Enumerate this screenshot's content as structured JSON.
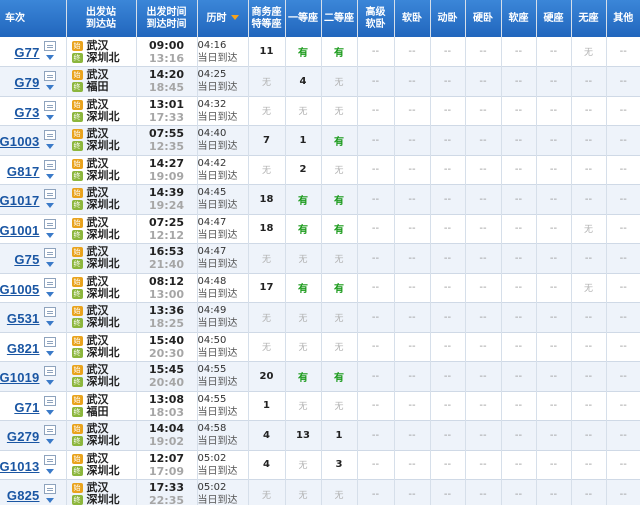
{
  "header": {
    "train": "车次",
    "station_from": "出发站",
    "station_to": "到达站",
    "time_dep": "出发时间",
    "time_arr": "到达时间",
    "duration": "历时",
    "seats": [
      {
        "line1": "商务座",
        "line2": "特等座"
      },
      {
        "line1": "一等座",
        "line2": ""
      },
      {
        "line1": "二等座",
        "line2": ""
      },
      {
        "line1": "高级",
        "line2": "软卧"
      },
      {
        "line1": "软卧",
        "line2": ""
      },
      {
        "line1": "动卧",
        "line2": ""
      },
      {
        "line1": "硬卧",
        "line2": ""
      },
      {
        "line1": "软座",
        "line2": ""
      },
      {
        "line1": "硬座",
        "line2": ""
      },
      {
        "line1": "无座",
        "line2": ""
      },
      {
        "line1": "其他",
        "line2": ""
      }
    ]
  },
  "accent": {
    "header_blue": "#2a72c9",
    "link_blue": "#1a56a3",
    "available_green": "#1a9a1a",
    "from_badge": "#e9a31d",
    "to_badge": "#8cb63c"
  },
  "icons": {
    "from_badge": "始",
    "to_badge": "终",
    "stopover": "list-icon",
    "expand": "chevron-down-icon",
    "sort": "sort-arrow-icon"
  },
  "rows": [
    {
      "train": "G77",
      "from": "武汉",
      "to": "深圳北",
      "dep": "09:00",
      "arr": "13:16",
      "dur": "04:16",
      "day": "当日到达",
      "seats": [
        "11",
        "有",
        "有",
        "--",
        "--",
        "--",
        "--",
        "--",
        "--",
        "无",
        "--"
      ]
    },
    {
      "train": "G79",
      "from": "武汉",
      "to": "福田",
      "dep": "14:20",
      "arr": "18:45",
      "dur": "04:25",
      "day": "当日到达",
      "seats": [
        "无",
        "4",
        "无",
        "--",
        "--",
        "--",
        "--",
        "--",
        "--",
        "--",
        "--"
      ]
    },
    {
      "train": "G73",
      "from": "武汉",
      "to": "深圳北",
      "dep": "13:01",
      "arr": "17:33",
      "dur": "04:32",
      "day": "当日到达",
      "seats": [
        "无",
        "无",
        "无",
        "--",
        "--",
        "--",
        "--",
        "--",
        "--",
        "--",
        "--"
      ]
    },
    {
      "train": "G1003",
      "from": "武汉",
      "to": "深圳北",
      "dep": "07:55",
      "arr": "12:35",
      "dur": "04:40",
      "day": "当日到达",
      "seats": [
        "7",
        "1",
        "有",
        "--",
        "--",
        "--",
        "--",
        "--",
        "--",
        "--",
        "--"
      ]
    },
    {
      "train": "G817",
      "from": "武汉",
      "to": "深圳北",
      "dep": "14:27",
      "arr": "19:09",
      "dur": "04:42",
      "day": "当日到达",
      "seats": [
        "无",
        "2",
        "无",
        "--",
        "--",
        "--",
        "--",
        "--",
        "--",
        "--",
        "--"
      ]
    },
    {
      "train": "G1017",
      "from": "武汉",
      "to": "深圳北",
      "dep": "14:39",
      "arr": "19:24",
      "dur": "04:45",
      "day": "当日到达",
      "seats": [
        "18",
        "有",
        "有",
        "--",
        "--",
        "--",
        "--",
        "--",
        "--",
        "--",
        "--"
      ]
    },
    {
      "train": "G1001",
      "from": "武汉",
      "to": "深圳北",
      "dep": "07:25",
      "arr": "12:12",
      "dur": "04:47",
      "day": "当日到达",
      "seats": [
        "18",
        "有",
        "有",
        "--",
        "--",
        "--",
        "--",
        "--",
        "--",
        "无",
        "--"
      ]
    },
    {
      "train": "G75",
      "from": "武汉",
      "to": "深圳北",
      "dep": "16:53",
      "arr": "21:40",
      "dur": "04:47",
      "day": "当日到达",
      "seats": [
        "无",
        "无",
        "无",
        "--",
        "--",
        "--",
        "--",
        "--",
        "--",
        "--",
        "--"
      ]
    },
    {
      "train": "G1005",
      "from": "武汉",
      "to": "深圳北",
      "dep": "08:12",
      "arr": "13:00",
      "dur": "04:48",
      "day": "当日到达",
      "seats": [
        "17",
        "有",
        "有",
        "--",
        "--",
        "--",
        "--",
        "--",
        "--",
        "无",
        "--"
      ]
    },
    {
      "train": "G531",
      "from": "武汉",
      "to": "深圳北",
      "dep": "13:36",
      "arr": "18:25",
      "dur": "04:49",
      "day": "当日到达",
      "seats": [
        "无",
        "无",
        "无",
        "--",
        "--",
        "--",
        "--",
        "--",
        "--",
        "--",
        "--"
      ]
    },
    {
      "train": "G821",
      "from": "武汉",
      "to": "深圳北",
      "dep": "15:40",
      "arr": "20:30",
      "dur": "04:50",
      "day": "当日到达",
      "seats": [
        "无",
        "无",
        "无",
        "--",
        "--",
        "--",
        "--",
        "--",
        "--",
        "--",
        "--"
      ]
    },
    {
      "train": "G1019",
      "from": "武汉",
      "to": "深圳北",
      "dep": "15:45",
      "arr": "20:40",
      "dur": "04:55",
      "day": "当日到达",
      "seats": [
        "20",
        "有",
        "有",
        "--",
        "--",
        "--",
        "--",
        "--",
        "--",
        "--",
        "--"
      ]
    },
    {
      "train": "G71",
      "from": "武汉",
      "to": "福田",
      "dep": "13:08",
      "arr": "18:03",
      "dur": "04:55",
      "day": "当日到达",
      "seats": [
        "1",
        "无",
        "无",
        "--",
        "--",
        "--",
        "--",
        "--",
        "--",
        "--",
        "--"
      ]
    },
    {
      "train": "G279",
      "from": "武汉",
      "to": "深圳北",
      "dep": "14:04",
      "arr": "19:02",
      "dur": "04:58",
      "day": "当日到达",
      "seats": [
        "4",
        "13",
        "1",
        "--",
        "--",
        "--",
        "--",
        "--",
        "--",
        "--",
        "--"
      ]
    },
    {
      "train": "G1013",
      "from": "武汉",
      "to": "深圳北",
      "dep": "12:07",
      "arr": "17:09",
      "dur": "05:02",
      "day": "当日到达",
      "seats": [
        "4",
        "无",
        "3",
        "--",
        "--",
        "--",
        "--",
        "--",
        "--",
        "--",
        "--"
      ]
    },
    {
      "train": "G825",
      "from": "武汉",
      "to": "深圳北",
      "dep": "17:33",
      "arr": "22:35",
      "dur": "05:02",
      "day": "当日到达",
      "seats": [
        "无",
        "无",
        "无",
        "--",
        "--",
        "--",
        "--",
        "--",
        "--",
        "--",
        "--"
      ]
    }
  ]
}
